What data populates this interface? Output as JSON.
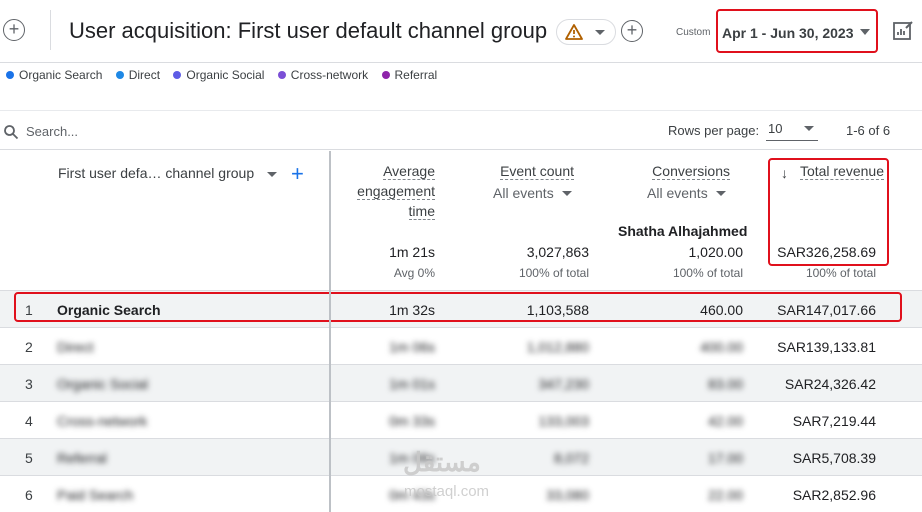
{
  "header": {
    "title": "User acquisition: First user default channel group",
    "custom_label": "Custom",
    "date_range": "Apr 1 - Jun 30, 2023"
  },
  "legend": [
    {
      "label": "Organic Search",
      "color": "#1a73e8"
    },
    {
      "label": "Direct",
      "color": "#1e88e5"
    },
    {
      "label": "Organic Social",
      "color": "#5e5ce6"
    },
    {
      "label": "Cross-network",
      "color": "#7b4fd6"
    },
    {
      "label": "Referral",
      "color": "#8e24aa"
    }
  ],
  "search": {
    "placeholder": "Search..."
  },
  "pagination": {
    "rows_per_page_label": "Rows per page:",
    "rows_per_page": "10",
    "range": "1-6 of 6"
  },
  "table": {
    "dimension_header": "First user defa… channel group",
    "columns": [
      {
        "line1": "Average",
        "line2": "engagement",
        "line3": "time",
        "total": "1m 21s",
        "pct": "Avg 0%"
      },
      {
        "line1": "Event count",
        "sub": "All events",
        "total": "3,027,863",
        "pct": "100% of total"
      },
      {
        "line1": "Conversions",
        "sub": "All events",
        "total": "1,020.00",
        "pct": "100% of total"
      },
      {
        "line1": "Total revenue",
        "total": "SAR326,258.69",
        "pct": "100% of total"
      }
    ],
    "annotation_name": "Shatha Alhajahmed",
    "rows": [
      {
        "idx": "1",
        "name": "Organic Search",
        "engagement": "1m 32s",
        "events": "1,103,588",
        "conversions": "460.00",
        "revenue": "SAR147,017.66"
      },
      {
        "idx": "2",
        "name": "Direct",
        "engagement": "1m 06s",
        "events": "1,012,880",
        "conversions": "400.00",
        "revenue": "SAR139,133.81"
      },
      {
        "idx": "3",
        "name": "Organic Social",
        "engagement": "1m 01s",
        "events": "347,230",
        "conversions": "83.00",
        "revenue": "SAR24,326.42"
      },
      {
        "idx": "4",
        "name": "Cross-network",
        "engagement": "0m 33s",
        "events": "133,003",
        "conversions": "42.00",
        "revenue": "SAR7,219.44"
      },
      {
        "idx": "5",
        "name": "Referral",
        "engagement": "1m 08s",
        "events": "8,072",
        "conversions": "17.00",
        "revenue": "SAR5,708.39"
      },
      {
        "idx": "6",
        "name": "Paid Search",
        "engagement": "0m 43s",
        "events": "33,080",
        "conversions": "22.00",
        "revenue": "SAR2,852.96"
      }
    ]
  },
  "watermark": {
    "arabic": "مستقل",
    "latin": "mostaql.com"
  }
}
